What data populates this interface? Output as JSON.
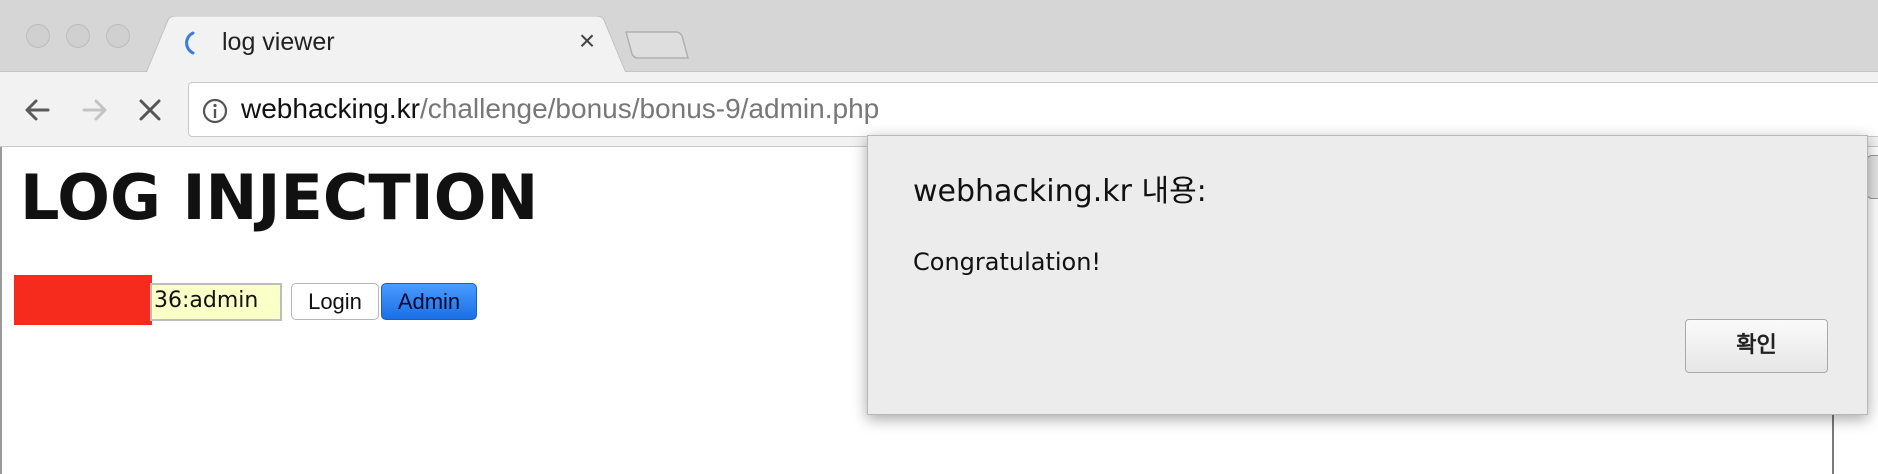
{
  "browser": {
    "tab": {
      "title": "log viewer",
      "close_glyph": "×"
    },
    "address": {
      "host": "webhacking.kr",
      "path": "/challenge/bonus/bonus-9/admin.php"
    },
    "icons": {
      "back": "back-arrow-icon",
      "forward": "forward-arrow-icon",
      "stop": "stop-icon",
      "info": "info-icon",
      "loading": "loading-spinner-icon"
    }
  },
  "page": {
    "heading": "LOG INJECTION",
    "id_field_value": "36:admin",
    "login_label": "Login",
    "admin_label": "Admin"
  },
  "dialog": {
    "title": "webhacking.kr 내용:",
    "message": "Congratulation!",
    "ok_label": "확인"
  },
  "colors": {
    "redaction": "#f62a1d",
    "admin_button": "#1a6fe6",
    "id_field_bg": "#fbffc8"
  }
}
